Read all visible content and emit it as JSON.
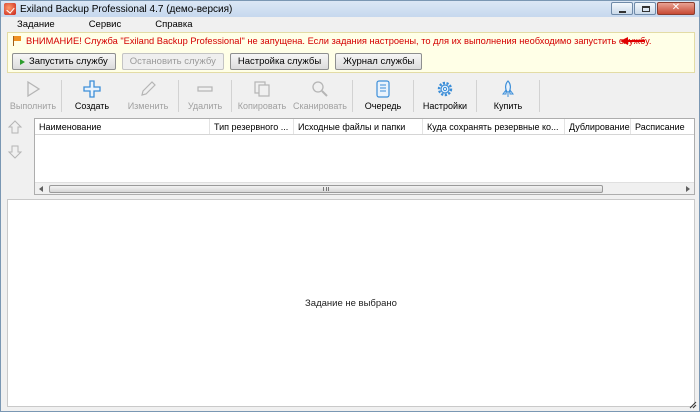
{
  "window": {
    "title": "Exiland Backup Professional 4.7 (демо-версия)"
  },
  "menu": {
    "items": [
      "Задание",
      "Сервис",
      "Справка"
    ]
  },
  "warning": {
    "text": "ВНИМАНИЕ! Служба \"Exiland Backup Professional\" не запущена. Если задания настроены, то для их выполнения необходимо запустить службу.",
    "buttons": {
      "start": "Запустить службу",
      "stop": "Остановить службу",
      "settings": "Настройка службы",
      "log": "Журнал службы"
    }
  },
  "toolbar": {
    "items": [
      {
        "label": "Выполнить",
        "icon": "play-icon"
      },
      {
        "label": "Создать",
        "icon": "plus-icon"
      },
      {
        "label": "Изменить",
        "icon": "pencil-icon"
      },
      {
        "label": "Удалить",
        "icon": "minus-icon"
      },
      {
        "label": "Копировать",
        "icon": "copy-icon"
      },
      {
        "label": "Сканировать",
        "icon": "magnifier-icon"
      },
      {
        "label": "Очередь",
        "icon": "queue-icon"
      },
      {
        "label": "Настройки",
        "icon": "gear-icon"
      },
      {
        "label": "Купить",
        "icon": "rocket-icon"
      }
    ]
  },
  "grid": {
    "columns": [
      "Наименование",
      "Тип резервного ...",
      "Исходные файлы и папки",
      "Куда сохранять резервные ко...",
      "Дублирование",
      "Расписание"
    ]
  },
  "details": {
    "empty_text": "Задание не выбрано"
  },
  "colors": {
    "warning_text": "#d40000",
    "warning_bg": "#ffffe7",
    "accent_blue": "#3c8ed8"
  }
}
